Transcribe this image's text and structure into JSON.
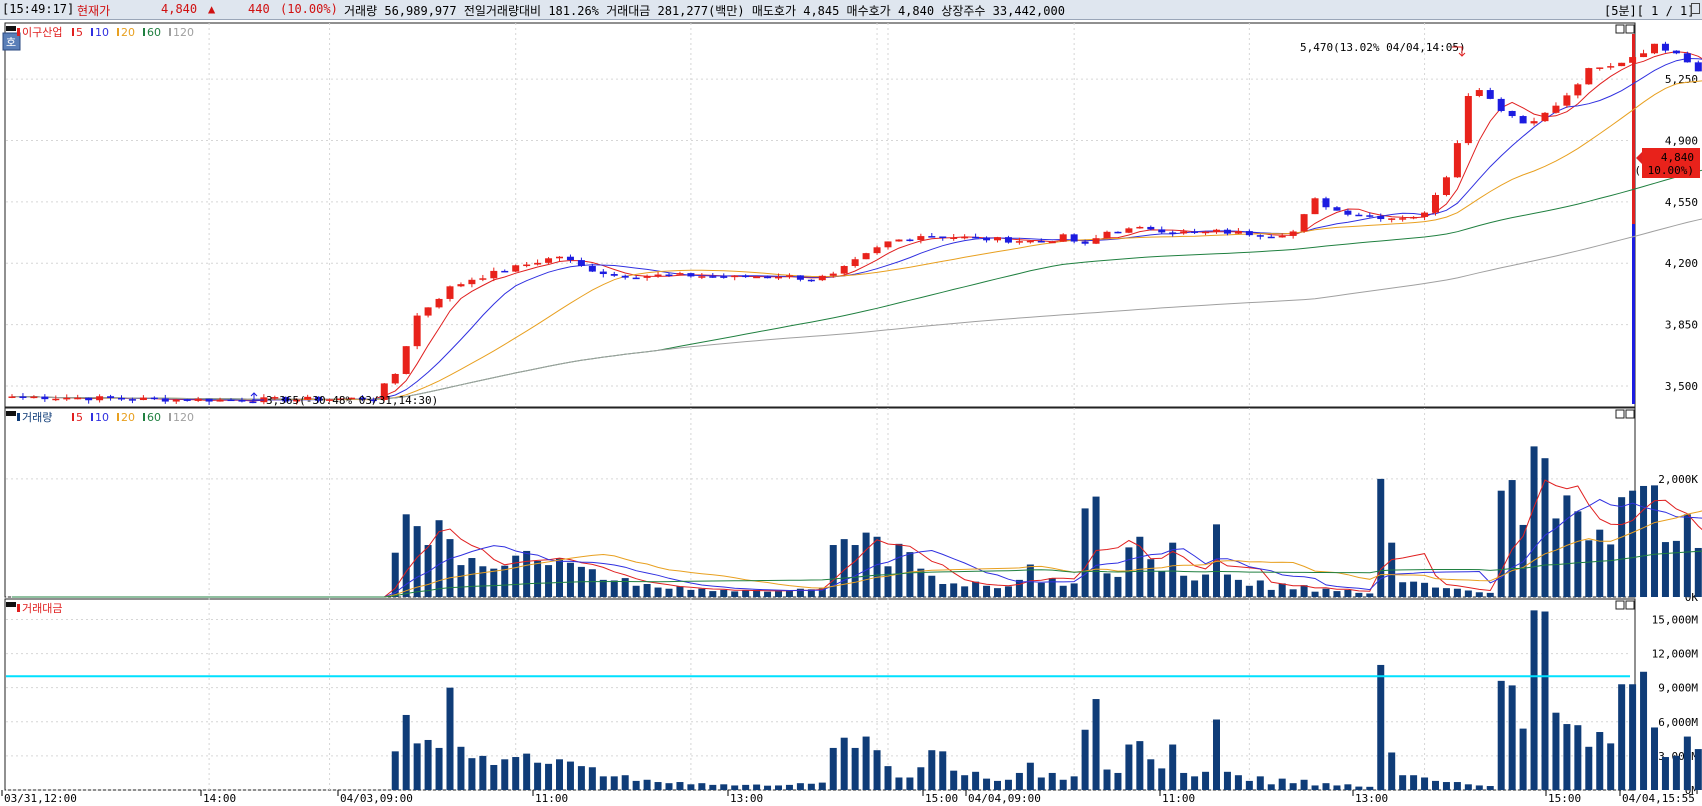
{
  "header": {
    "time": "[15:49:17]",
    "label_current": "현재가",
    "price": "4,840",
    "arrow": "▲",
    "change": "440",
    "change_pct": "(10.00%)",
    "volume_info": "거래량 56,989,977  전일거래량대비 181.26%  거래대금 281,277(백만)  매도호가 4,845  매수호가 4,840  상장주수 33,442,000",
    "period": "[5분][ 1 / 1]"
  },
  "panes": {
    "price": {
      "label": "이구산업",
      "toggle": "호"
    },
    "volume": {
      "label": "거래량"
    },
    "amount": {
      "label": "거래대금"
    }
  },
  "ma_labels": [
    "5",
    "10",
    "20",
    "60",
    "120"
  ],
  "colors": {
    "up": "#e8221b",
    "down": "#1c1ce0",
    "bar": "#0f3c78",
    "ma5": "#e02020",
    "ma10": "#3030e0",
    "ma20": "#e8a020",
    "ma60": "#208040",
    "ma120": "#a0a0a0",
    "hline": "#00e0ff"
  },
  "current": {
    "price_label": "4,840",
    "pct_label": "( 10.00%)"
  },
  "chart_data": {
    "type": "candlestick",
    "x_ticks": [
      "03/31,12:00",
      "14:00",
      "04/03,09:00",
      "11:00",
      "13:00",
      "15:00",
      "04/04,09:00",
      "11:00",
      "13:00",
      "15:00",
      "04/04,15:55"
    ],
    "price_ticks": [
      "5,250",
      "4,900",
      "4,550",
      "4,200",
      "3,850",
      "3,500"
    ],
    "price_tick_values": [
      5250,
      4900,
      4550,
      4200,
      3850,
      3500
    ],
    "price_range": [
      3380,
      5570
    ],
    "volume_ticks": [
      "2,000K",
      "0K"
    ],
    "volume_tick_values": [
      2000,
      0
    ],
    "volume_range": [
      0,
      3200
    ],
    "amount_ticks": [
      "15,000M",
      "12,000M",
      "9,000M",
      "6,000M",
      "3,000M",
      "0M"
    ],
    "amount_tick_values": [
      15000,
      12000,
      9000,
      6000,
      3000,
      0
    ],
    "amount_range": [
      0,
      16800
    ],
    "amount_hline": 10000,
    "annotations": {
      "high": {
        "text": "5,470(13.02% 04/04,14:05)",
        "value": 5470
      },
      "low": {
        "text": "3,365(-30.48% 03/31,14:30)",
        "value": 3365
      }
    },
    "price_anchors": [
      [
        0,
        3440
      ],
      [
        12,
        3425
      ],
      [
        20,
        3420
      ],
      [
        28,
        3425
      ],
      [
        33,
        3430
      ],
      [
        35,
        3570
      ],
      [
        37,
        3900
      ],
      [
        40,
        4060
      ],
      [
        42,
        4110
      ],
      [
        45,
        4160
      ],
      [
        48,
        4210
      ],
      [
        50,
        4240
      ],
      [
        52,
        4180
      ],
      [
        55,
        4130
      ],
      [
        58,
        4130
      ],
      [
        62,
        4130
      ],
      [
        66,
        4120
      ],
      [
        70,
        4130
      ],
      [
        73,
        4110
      ],
      [
        75,
        4130
      ],
      [
        77,
        4210
      ],
      [
        80,
        4320
      ],
      [
        83,
        4360
      ],
      [
        86,
        4350
      ],
      [
        88,
        4340
      ],
      [
        92,
        4330
      ],
      [
        94,
        4320
      ],
      [
        96,
        4350
      ],
      [
        98,
        4300
      ],
      [
        100,
        4380
      ],
      [
        104,
        4400
      ],
      [
        106,
        4380
      ],
      [
        108,
        4370
      ],
      [
        110,
        4380
      ],
      [
        113,
        4370
      ],
      [
        115,
        4360
      ],
      [
        117,
        4380
      ],
      [
        119,
        4560
      ],
      [
        121,
        4500
      ],
      [
        124,
        4470
      ],
      [
        126,
        4460
      ],
      [
        128,
        4470
      ],
      [
        129,
        4480
      ],
      [
        130,
        4600
      ],
      [
        131,
        4700
      ],
      [
        132,
        4900
      ],
      [
        133,
        5150
      ],
      [
        134,
        5200
      ],
      [
        136,
        5080
      ],
      [
        138,
        5000
      ],
      [
        140,
        5050
      ],
      [
        142,
        5150
      ],
      [
        144,
        5300
      ],
      [
        146,
        5320
      ],
      [
        148,
        5380
      ],
      [
        150,
        5440
      ],
      [
        152,
        5410
      ],
      [
        154,
        5300
      ],
      [
        156,
        5230
      ],
      [
        158,
        5180
      ],
      [
        160,
        5050
      ],
      [
        162,
        4860
      ],
      [
        163,
        4840
      ]
    ],
    "volume_values": [
      0,
      0,
      0,
      0,
      0,
      0,
      0,
      0,
      0,
      0,
      0,
      0,
      0,
      0,
      0,
      0,
      0,
      0,
      0,
      0,
      0,
      0,
      0,
      0,
      0,
      0,
      0,
      0,
      0,
      0,
      0,
      0,
      0,
      0,
      0,
      750,
      1400,
      1200,
      880,
      1300,
      980,
      540,
      660,
      520,
      480,
      530,
      700,
      780,
      610,
      540,
      660,
      580,
      510,
      470,
      290,
      280,
      320,
      190,
      220,
      160,
      140,
      180,
      120,
      140,
      100,
      120,
      95,
      110,
      120,
      90,
      100,
      110,
      140,
      130,
      160,
      880,
      980,
      880,
      1090,
      1020,
      520,
      900,
      760,
      480,
      360,
      220,
      230,
      180,
      260,
      190,
      150,
      180,
      290,
      550,
      240,
      320,
      190,
      230,
      1500,
      1700,
      400,
      340,
      840,
      1020,
      640,
      440,
      920,
      360,
      280,
      380,
      1230,
      380,
      290,
      190,
      280,
      120,
      230,
      130,
      200,
      90,
      140,
      100,
      120,
      70,
      60,
      2000,
      920,
      250,
      260,
      240,
      160,
      150,
      140,
      110,
      80,
      70,
      1800,
      1980,
      1220,
      2550,
      2350,
      1330,
      1720,
      1450,
      960,
      1140,
      890,
      1690,
      1800,
      1880,
      1890,
      930,
      950,
      1400,
      830,
      1050,
      950,
      1850,
      820,
      560,
      1210,
      1120,
      930,
      1110,
      1120,
      800,
      720,
      1230
    ],
    "amount_values": [
      0,
      0,
      0,
      0,
      0,
      0,
      0,
      0,
      0,
      0,
      0,
      0,
      0,
      0,
      0,
      0,
      0,
      0,
      0,
      0,
      0,
      0,
      0,
      0,
      0,
      0,
      0,
      0,
      0,
      0,
      0,
      0,
      0,
      0,
      0,
      3400,
      6600,
      4100,
      4400,
      3700,
      9000,
      3800,
      2800,
      3000,
      2200,
      2700,
      2900,
      3200,
      2400,
      2300,
      2700,
      2500,
      2100,
      2000,
      1200,
      1200,
      1300,
      800,
      900,
      700,
      600,
      700,
      500,
      600,
      450,
      500,
      400,
      450,
      480,
      380,
      400,
      450,
      600,
      550,
      650,
      3700,
      4600,
      3700,
      4700,
      3500,
      2100,
      1100,
      1100,
      2000,
      3500,
      3400,
      1700,
      1300,
      1600,
      1000,
      800,
      900,
      1500,
      2400,
      1100,
      1500,
      900,
      1200,
      5300,
      8000,
      1800,
      1500,
      4000,
      4300,
      2700,
      1900,
      4000,
      1500,
      1200,
      1600,
      6200,
      1600,
      1300,
      800,
      1200,
      500,
      1000,
      600,
      900,
      400,
      600,
      400,
      500,
      300,
      280,
      11000,
      3300,
      1300,
      1300,
      1100,
      800,
      700,
      700,
      500,
      400,
      350,
      9600,
      9200,
      5400,
      15800,
      15700,
      6800,
      5800,
      5700,
      3800,
      5100,
      4100,
      9300,
      9300,
      10400,
      5500,
      2900,
      3000,
      4700,
      3600,
      10300,
      4600,
      3800,
      4900,
      2400,
      5200,
      4000,
      2800,
      4000,
      3700,
      2300,
      2200,
      4200
    ]
  }
}
